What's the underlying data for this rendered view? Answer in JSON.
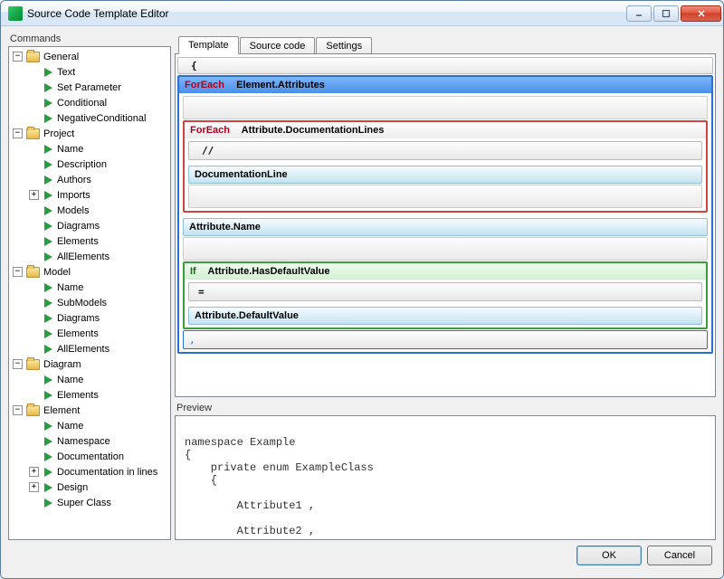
{
  "window": {
    "title": "Source Code Template Editor"
  },
  "commands": {
    "label": "Commands",
    "groups": [
      {
        "name": "General",
        "expanded": true,
        "items": [
          {
            "label": "Text"
          },
          {
            "label": "Set Parameter"
          },
          {
            "label": "Conditional"
          },
          {
            "label": "NegativeConditional"
          }
        ]
      },
      {
        "name": "Project",
        "expanded": true,
        "items": [
          {
            "label": "Name"
          },
          {
            "label": "Description"
          },
          {
            "label": "Authors"
          },
          {
            "label": "Imports",
            "hasChildren": true
          },
          {
            "label": "Models"
          },
          {
            "label": "Diagrams"
          },
          {
            "label": "Elements"
          },
          {
            "label": "AllElements"
          }
        ]
      },
      {
        "name": "Model",
        "expanded": true,
        "items": [
          {
            "label": "Name"
          },
          {
            "label": "SubModels"
          },
          {
            "label": "Diagrams"
          },
          {
            "label": "Elements"
          },
          {
            "label": "AllElements"
          }
        ]
      },
      {
        "name": "Diagram",
        "expanded": true,
        "items": [
          {
            "label": "Name"
          },
          {
            "label": "Elements"
          }
        ]
      },
      {
        "name": "Element",
        "expanded": true,
        "items": [
          {
            "label": "Name"
          },
          {
            "label": "Namespace"
          },
          {
            "label": "Documentation"
          },
          {
            "label": "Documentation in lines",
            "hasChildren": true
          },
          {
            "label": "Design",
            "hasChildren": true
          },
          {
            "label": "Super Class"
          }
        ]
      }
    ]
  },
  "tabs": {
    "items": [
      "Template",
      "Source code",
      "Settings"
    ],
    "active": 0
  },
  "template": {
    "openBrace": "{",
    "foreachAttrs": {
      "kw": "ForEach",
      "expr": "Element.Attributes"
    },
    "foreachDocs": {
      "kw": "ForEach",
      "expr": "Attribute.DocumentationLines"
    },
    "commentSlashes": "//",
    "docLine": "DocumentationLine",
    "attrName": "Attribute.Name",
    "ifDefault": {
      "kw": "If",
      "expr": "Attribute.HasDefaultValue"
    },
    "equals": "=",
    "defaultVal": "Attribute.DefaultValue",
    "comma": ","
  },
  "preview": {
    "label": "Preview",
    "text": "\nnamespace Example\n{\n    private enum ExampleClass\n    {\n\n        Attribute1 ,\n\n        Attribute2 ,"
  },
  "buttons": {
    "ok": "OK",
    "cancel": "Cancel"
  }
}
